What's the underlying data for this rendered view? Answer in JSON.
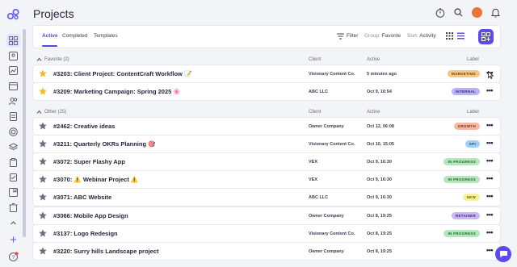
{
  "header": {
    "title": "Projects"
  },
  "toolbar": {
    "tabs": [
      {
        "label": "Active"
      },
      {
        "label": "Completed"
      },
      {
        "label": "Templates"
      }
    ],
    "filter_label": "Filter",
    "group_prefix": "Group:",
    "group_value": "Favorite",
    "sort_prefix": "Sort:",
    "sort_value": "Activity"
  },
  "columns": {
    "client": "Client",
    "active": "Active",
    "label": "Label"
  },
  "groups": [
    {
      "name": "Favorite (2)",
      "rows": [
        {
          "title": "#3203: Client Project: ContentCraft Workflow 📝",
          "client": "Visionary Content Co.",
          "active": "5 minutes ago",
          "label": "MARKETING",
          "favorite": true
        },
        {
          "title": "#3209: Marketing Campaign: Spring 2025 🌸",
          "client": "ABC LLC",
          "active": "Oct 9, 16:54",
          "label": "INTERNAL",
          "favorite": true
        }
      ]
    },
    {
      "name": "Other (25)",
      "rows": [
        {
          "title": "#2462: Creative ideas",
          "client": "Owner Company",
          "active": "Oct 12, 06:08",
          "label": "GROWTH",
          "favorite": false
        },
        {
          "title": "#3211: Quarterly OKRs Planning 🎯",
          "client": "Visionary Content Co.",
          "active": "Oct 10, 15:05",
          "label": "API",
          "favorite": false
        },
        {
          "title": "#3072: Super Flashy App",
          "client": "VEX",
          "active": "Oct 9, 16:30",
          "label": "IN PROGRESS",
          "favorite": false
        },
        {
          "title": "#3070: ⚠️ Webinar Project ⚠️",
          "client": "VEX",
          "active": "Oct 9, 16:30",
          "label": "IN PROGRESS",
          "favorite": false
        },
        {
          "title": "#3071: ABC Website",
          "client": "ABC LLC",
          "active": "Oct 9, 16:30",
          "label": "NEW",
          "favorite": false
        },
        {
          "title": "#3066: Mobile App Design",
          "client": "Owner Company",
          "active": "Oct 8, 19:25",
          "label": "RETAINER",
          "favorite": false
        },
        {
          "title": "#3137: Logo Redesign",
          "client": "Visionary Content Co.",
          "active": "Oct 8, 19:25",
          "label": "IN PROGRESS",
          "favorite": false
        },
        {
          "title": "#3220: Surry hills Landscape project",
          "client": "Owner Company",
          "active": "Oct 8, 19:25",
          "label": "",
          "favorite": false
        }
      ]
    }
  ],
  "label_colors": {
    "MARKETING": {
      "bg": "#f6c784",
      "fg": "#6b3d00"
    },
    "INTERNAL": {
      "bg": "#b9b3f3",
      "fg": "#2f2a7a"
    },
    "GROWTH": {
      "bg": "#f4b9a3",
      "fg": "#7a2e12"
    },
    "API": {
      "bg": "#9fcff5",
      "fg": "#0d4a78"
    },
    "IN PROGRESS": {
      "bg": "#b6e6bd",
      "fg": "#1d6b2b"
    },
    "NEW": {
      "bg": "#f7f09a",
      "fg": "#6b6200"
    },
    "RETAINER": {
      "bg": "#c7b8f2",
      "fg": "#3f2a86"
    }
  },
  "icons": {
    "sidebar": [
      "dashboard-icon",
      "contacts-icon",
      "chart-icon",
      "calendar-icon",
      "people-icon",
      "document-icon",
      "target-icon",
      "stack-icon",
      "clipboard-icon",
      "checklist-icon",
      "bookmark-icon",
      "archive-icon",
      "trash-icon"
    ],
    "header": [
      "timer-icon",
      "search-icon",
      "avatar",
      "bell-icon"
    ]
  }
}
